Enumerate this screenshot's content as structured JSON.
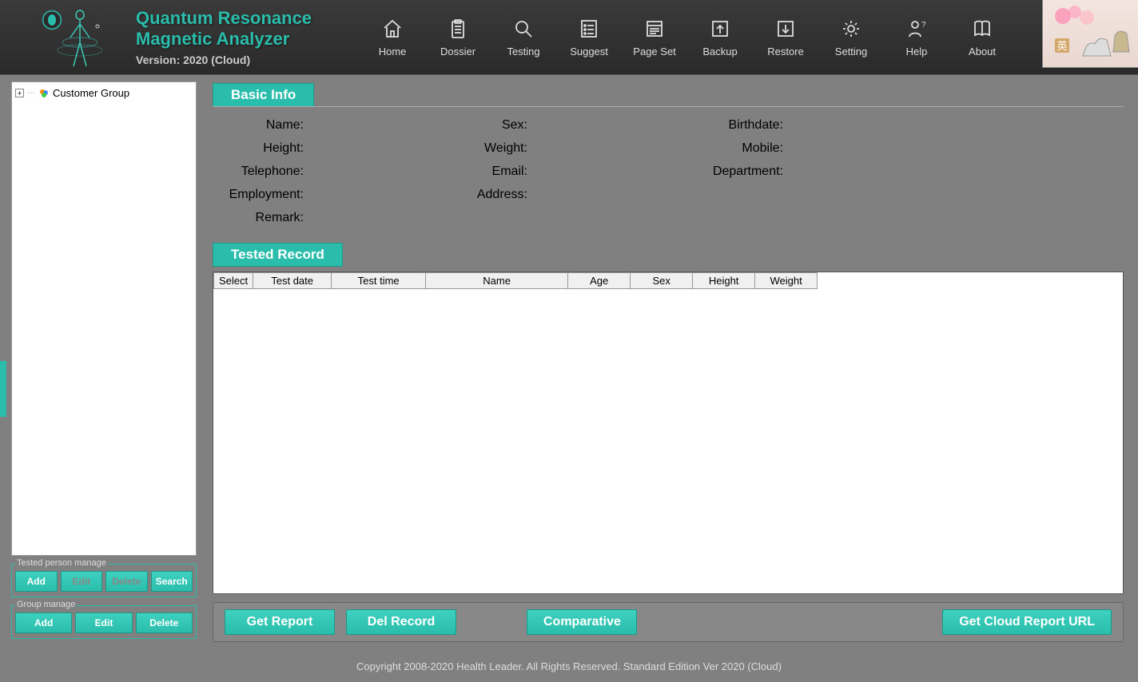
{
  "header": {
    "title_line1": "Quantum Resonance",
    "title_line2": "Magnetic Analyzer",
    "version": "Version: 2020 (Cloud)",
    "toolbar": [
      {
        "label": "Home",
        "icon": "home"
      },
      {
        "label": "Dossier",
        "icon": "clipboard"
      },
      {
        "label": "Testing",
        "icon": "search"
      },
      {
        "label": "Suggest",
        "icon": "list"
      },
      {
        "label": "Page Set",
        "icon": "page"
      },
      {
        "label": "Backup",
        "icon": "upload"
      },
      {
        "label": "Restore",
        "icon": "download"
      },
      {
        "label": "Setting",
        "icon": "gear"
      },
      {
        "label": "Help",
        "icon": "person-help"
      },
      {
        "label": "About",
        "icon": "book"
      }
    ]
  },
  "sidebar": {
    "tree_root": "Customer Group",
    "person_manage": {
      "legend": "Tested person manage",
      "add": "Add",
      "edit": "Edit",
      "delete": "Delete",
      "search": "Search"
    },
    "group_manage": {
      "legend": "Group manage",
      "add": "Add",
      "edit": "Edit",
      "delete": "Delete"
    }
  },
  "basic_info": {
    "tab": "Basic Info",
    "fields": {
      "name": "Name:",
      "sex": "Sex:",
      "birthdate": "Birthdate:",
      "height": "Height:",
      "weight": "Weight:",
      "mobile": "Mobile:",
      "telephone": "Telephone:",
      "email": "Email:",
      "department": "Department:",
      "employment": "Employment:",
      "address": "Address:",
      "remark": "Remark:"
    },
    "values": {
      "name": "",
      "sex": "",
      "birthdate": "",
      "height": "",
      "weight": "",
      "mobile": "",
      "telephone": "",
      "email": "",
      "department": "",
      "employment": "",
      "address": "",
      "remark": ""
    }
  },
  "tested_record": {
    "tab": "Tested Record",
    "columns": {
      "select": "Select",
      "test_date": "Test date",
      "test_time": "Test time",
      "name": "Name",
      "age": "Age",
      "sex": "Sex",
      "height": "Height",
      "weight": "Weight"
    },
    "rows": []
  },
  "actions": {
    "get_report": "Get Report",
    "del_record": "Del Record",
    "comparative": "Comparative",
    "get_cloud_url": "Get Cloud Report URL"
  },
  "footer": "Copyright 2008-2020 Health Leader. All Rights Reserved.  Standard Edition Ver 2020 (Cloud)"
}
